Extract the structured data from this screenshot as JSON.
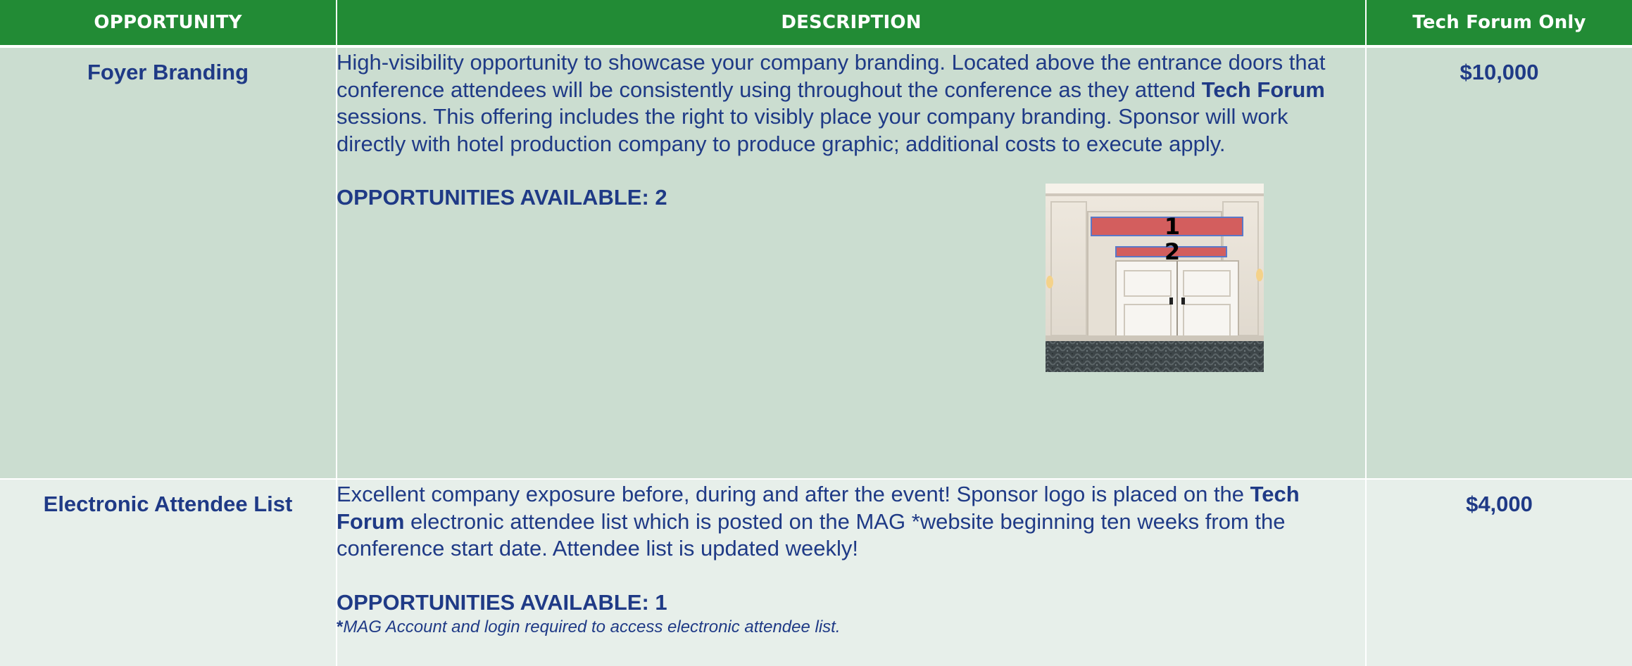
{
  "header": {
    "col_opportunity": "OPPORTUNITY",
    "col_description": "DESCRIPTION",
    "col_price": "Tech Forum Only"
  },
  "rows": [
    {
      "name": "Foyer Branding",
      "desc_1": "High-visibility opportunity to showcase your company branding.  Located above the entrance doors that conference attendees will be consistently using throughout the conference as they attend ",
      "desc_bold": "Tech Forum",
      "desc_2": " sessions. This offering includes the right to visibly place your company branding. Sponsor will work directly with hotel production company to produce graphic; additional costs to execute apply.",
      "available": "OPPORTUNITIES AVAILABLE: 2",
      "price": "$10,000",
      "photo_label_1": "1",
      "photo_label_2": "2"
    },
    {
      "name": "Electronic Attendee List",
      "desc_1": "Excellent company exposure before, during and after the event! Sponsor logo is placed on the ",
      "desc_bold": "Tech Forum",
      "desc_2": " electronic attendee list which is posted on the MAG *website beginning ten weeks from the conference start date. Attendee list is updated weekly!",
      "available": "OPPORTUNITIES AVAILABLE: 1",
      "footnote_mark": "*",
      "footnote": "MAG Account and login required to access electronic attendee list.",
      "price": "$4,000"
    }
  ],
  "colors": {
    "header_bg": "#228b35",
    "row_a_bg": "#cbddd0",
    "row_b_bg": "#e7efea",
    "text": "#1f3a86",
    "banner_fill": "#d35e5e",
    "banner_border": "#5a78c8"
  }
}
